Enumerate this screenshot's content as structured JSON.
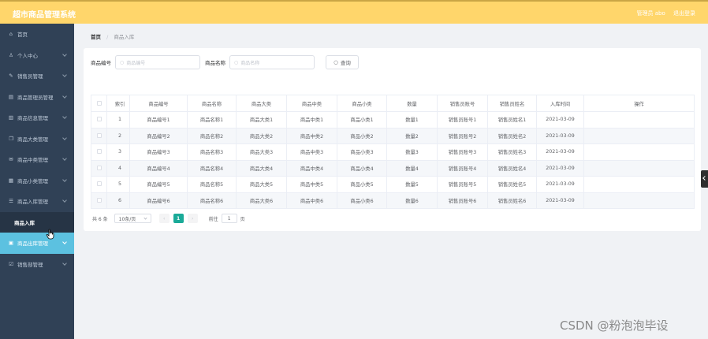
{
  "app": {
    "title": "超市商品管理系统",
    "admin_text": "管理员 abo",
    "logout_label": "退出登录"
  },
  "sidebar": {
    "items": [
      {
        "label": "首页",
        "icon": "home-icon",
        "chevron": false
      },
      {
        "label": "个人中心",
        "icon": "user-icon",
        "chevron": true
      },
      {
        "label": "销售员管理",
        "icon": "edit-icon",
        "chevron": true
      },
      {
        "label": "商品管理员管理",
        "icon": "document-icon",
        "chevron": true
      },
      {
        "label": "商品信息管理",
        "icon": "chart-icon",
        "chevron": true
      },
      {
        "label": "商品大类管理",
        "icon": "copy-icon",
        "chevron": true
      },
      {
        "label": "商品中类管理",
        "icon": "mail-icon",
        "chevron": true
      },
      {
        "label": "商品小类管理",
        "icon": "grid-icon",
        "chevron": true
      },
      {
        "label": "商品入库管理",
        "icon": "list-icon",
        "chevron": true
      }
    ],
    "submenu": {
      "label": "商品入库"
    },
    "after_items": [
      {
        "label": "商品出库管理",
        "icon": "shop-icon",
        "chevron": true,
        "active": true
      },
      {
        "label": "销售部管理",
        "icon": "check-icon",
        "chevron": true
      }
    ]
  },
  "breadcrumb": {
    "home": "首页",
    "separator": "/",
    "current": "商品入库"
  },
  "search": {
    "field1_label": "商品编号",
    "field1_placeholder": "商品编号",
    "field2_label": "商品名称",
    "field2_placeholder": "商品名称",
    "query_label": "查询"
  },
  "table": {
    "headers": [
      "索引",
      "商品编号",
      "商品名称",
      "商品大类",
      "商品中类",
      "商品小类",
      "数量",
      "销售员账号",
      "销售员姓名",
      "入库时间",
      "操作"
    ],
    "rows": [
      [
        "1",
        "商品编号1",
        "商品名称1",
        "商品大类1",
        "商品中类1",
        "商品小类1",
        "数量1",
        "销售员账号1",
        "销售员姓名1",
        "2021-03-09",
        ""
      ],
      [
        "2",
        "商品编号2",
        "商品名称2",
        "商品大类2",
        "商品中类2",
        "商品小类2",
        "数量2",
        "销售员账号2",
        "销售员姓名2",
        "2021-03-09",
        ""
      ],
      [
        "3",
        "商品编号3",
        "商品名称3",
        "商品大类3",
        "商品中类3",
        "商品小类3",
        "数量3",
        "销售员账号3",
        "销售员姓名3",
        "2021-03-09",
        ""
      ],
      [
        "4",
        "商品编号4",
        "商品名称4",
        "商品大类4",
        "商品中类4",
        "商品小类4",
        "数量4",
        "销售员账号4",
        "销售员姓名4",
        "2021-03-09",
        ""
      ],
      [
        "5",
        "商品编号5",
        "商品名称5",
        "商品大类5",
        "商品中类5",
        "商品小类5",
        "数量5",
        "销售员账号5",
        "销售员姓名5",
        "2021-03-09",
        ""
      ],
      [
        "6",
        "商品编号6",
        "商品名称6",
        "商品大类6",
        "商品中类6",
        "商品小类6",
        "数量6",
        "销售员账号6",
        "销售员姓名6",
        "2021-03-09",
        ""
      ]
    ]
  },
  "pagination": {
    "total_text": "共 6 条",
    "page_size": "10条/页",
    "prev": "‹",
    "current_page": "1",
    "next": "›",
    "goto_label": "前往",
    "goto_value": "1",
    "page_suffix": "页"
  },
  "watermark": "CSDN @粉泡泡毕设",
  "colors": {
    "topbar": "#ffd66b",
    "sidebar": "#304156",
    "active_menu": "#5cc1e0",
    "pager_active": "#1aaa98"
  }
}
